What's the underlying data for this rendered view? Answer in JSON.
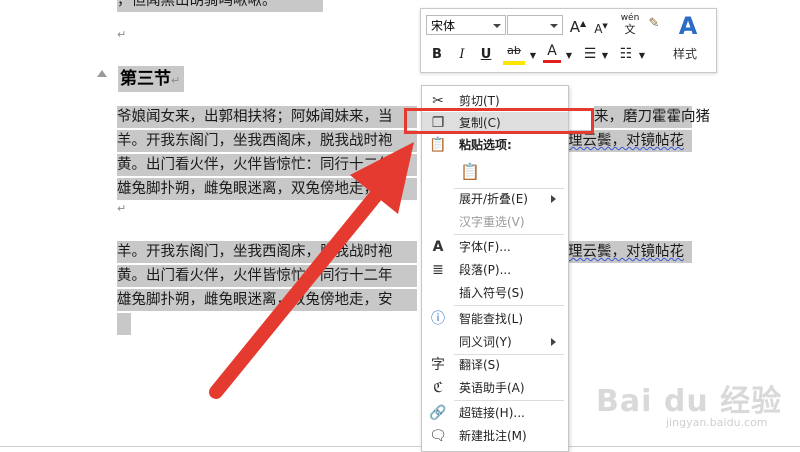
{
  "document": {
    "top_partial": "，但闻黑山胡骑鸣啾啾。",
    "heading": "第三节",
    "lines": [
      "爷娘闻女来，出郭相扶将；阿姊闻妹来，当",
      "羊。开我东阁门，坐我西阁床，脱我战时袍",
      "黄。出门看火伴，火伴皆惊忙：同行十二年",
      "雄兔脚扑朔，雌兔眼迷离，双兔傍地走，安",
      "羊。开我东阁门，坐我西阁床，脱我战时袍",
      "黄。出门看火伴，火伴皆惊忙：同行十二年",
      "雄兔脚扑朔，雌兔眼迷离，双兔傍地走，安"
    ],
    "right_fragments": [
      "来，磨刀霍霍向猪",
      "理云鬓，对镜帖花",
      "理云鬓，对镜帖花"
    ],
    "para_mark": "↵"
  },
  "mini_toolbar": {
    "font_name": "宋体",
    "font_size": "",
    "grow_font": "A",
    "shrink_font": "A",
    "phonetic": "wén",
    "phonetic_sub": "文",
    "bold": "B",
    "italic": "I",
    "underline": "U",
    "highlight": "ab",
    "font_color": "A",
    "styles_label": "样式"
  },
  "context_menu": {
    "items": [
      {
        "label": "剪切(T)",
        "icon": "scissors-icon"
      },
      {
        "label": "复制(C)",
        "icon": "copy-icon"
      },
      {
        "label": "粘贴选项:",
        "icon": "paste-icon"
      },
      {
        "label": "展开/折叠(E)",
        "icon": "",
        "submenu": true
      },
      {
        "label": "汉字重选(V)",
        "icon": "",
        "disabled": true
      },
      {
        "label": "字体(F)...",
        "icon": "font-icon"
      },
      {
        "label": "段落(P)...",
        "icon": "paragraph-icon"
      },
      {
        "label": "插入符号(S)",
        "icon": ""
      },
      {
        "label": "智能查找(L)",
        "icon": "smart-lookup-icon"
      },
      {
        "label": "同义词(Y)",
        "icon": "",
        "submenu": true
      },
      {
        "label": "翻译(S)",
        "icon": "translate-icon"
      },
      {
        "label": "英语助手(A)",
        "icon": "english-assistant-icon"
      },
      {
        "label": "超链接(H)...",
        "icon": "hyperlink-icon"
      },
      {
        "label": "新建批注(M)",
        "icon": "new-comment-icon"
      }
    ]
  },
  "watermark": {
    "brand": "Bai du 经验",
    "url": "jingyan.baidu.com"
  },
  "colors": {
    "selection": "#c8c8c8",
    "annotation_red": "#e53a2f",
    "highlight_yellow": "#ffe400",
    "font_red": "#e02020",
    "styles_blue": "#2b6cc4"
  }
}
